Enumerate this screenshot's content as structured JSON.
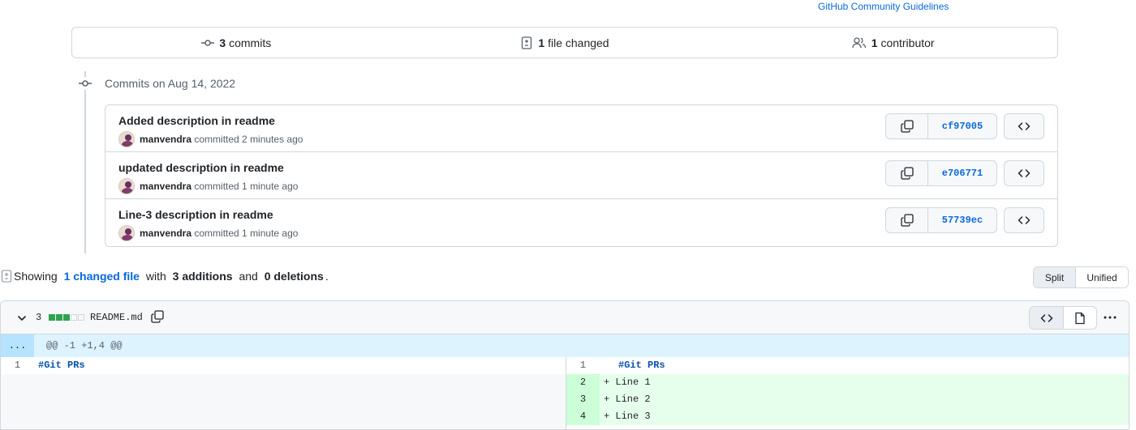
{
  "header": {
    "guidelines_link": "GitHub Community Guidelines"
  },
  "summary": {
    "commits_count": "3",
    "commits_label": "commits",
    "files_count": "1",
    "files_label": "file changed",
    "contributors_count": "1",
    "contributors_label": "contributor"
  },
  "timeline": {
    "date_label": "Commits on Aug 14, 2022"
  },
  "commits": [
    {
      "title": "Added description in readme",
      "author": "manvendra",
      "time": "committed 2 minutes ago",
      "sha": "cf97005"
    },
    {
      "title": "updated description in readme",
      "author": "manvendra",
      "time": "committed 1 minute ago",
      "sha": "e706771"
    },
    {
      "title": "Line-3 description in readme",
      "author": "manvendra",
      "time": "committed 1 minute ago",
      "sha": "57739ec"
    }
  ],
  "showing": {
    "prefix": "Showing",
    "changed_link": "1 changed file",
    "with": "with",
    "additions": "3 additions",
    "and": "and",
    "deletions": "0 deletions",
    "suffix": "."
  },
  "view_toggle": {
    "split": "Split",
    "unified": "Unified"
  },
  "file": {
    "change_count": "3",
    "name": "README.md",
    "diffstat": [
      "#2da44e",
      "#2da44e",
      "#2da44e",
      "#f6f8fa",
      "#f6f8fa"
    ],
    "hunk_expand": "...",
    "hunk_header": "@@ -1 +1,4 @@",
    "left_lines": [
      {
        "num": "1",
        "text": "#Git PRs"
      }
    ],
    "right_lines": [
      {
        "num": "1",
        "text": "#Git PRs",
        "type": "context"
      },
      {
        "num": "2",
        "text": "+ Line 1",
        "type": "add"
      },
      {
        "num": "3",
        "text": "+ Line 2",
        "type": "add"
      },
      {
        "num": "4",
        "text": "+ Line 3",
        "type": "add"
      }
    ]
  },
  "colors": {
    "link": "#0969da",
    "addition": "#2da44e",
    "border": "#d0d7de"
  }
}
